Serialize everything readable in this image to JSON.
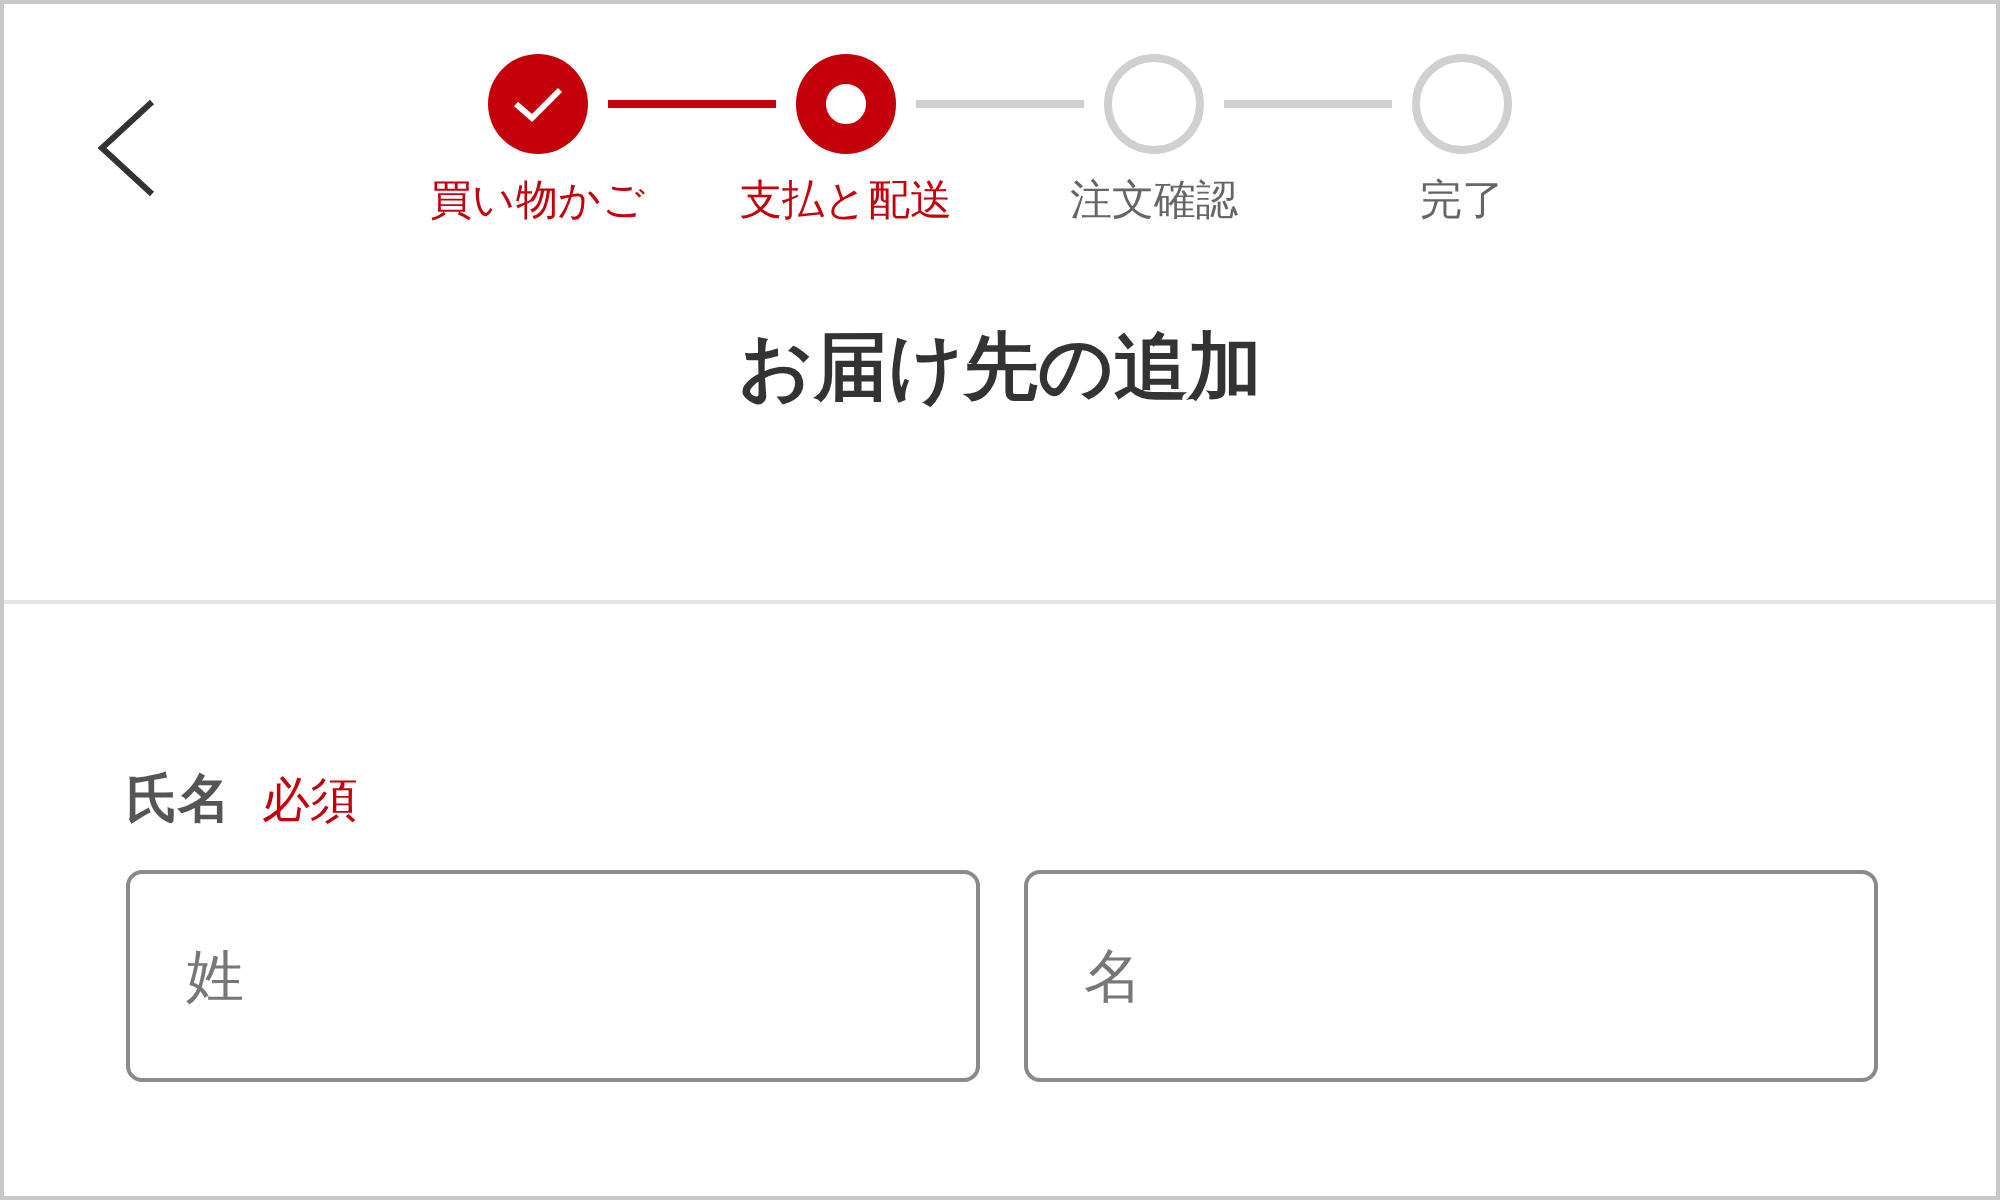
{
  "stepper": {
    "steps": [
      {
        "label": "買い物かご",
        "completed": true,
        "selected": false
      },
      {
        "label": "支払と配送",
        "completed": false,
        "selected": true
      },
      {
        "label": "注文確認",
        "completed": false,
        "selected": false
      },
      {
        "label": "完了",
        "completed": false,
        "selected": false
      }
    ]
  },
  "title": "お届け先の追加",
  "form": {
    "fields": [
      {
        "label": "氏名",
        "required_badge": "必須",
        "inputs": [
          {
            "placeholder": "姓"
          },
          {
            "placeholder": "名"
          }
        ]
      }
    ]
  }
}
